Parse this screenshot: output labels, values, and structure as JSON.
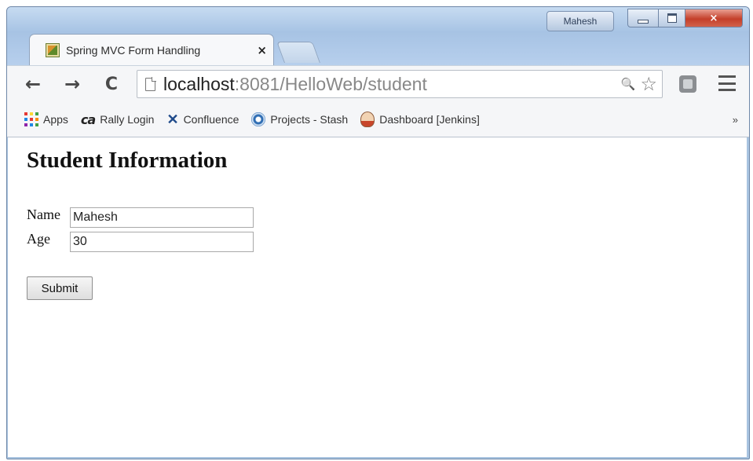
{
  "window": {
    "user_badge": "Mahesh",
    "controls": {
      "minimize": "minimize",
      "maximize": "maximize",
      "close": "×"
    }
  },
  "tab": {
    "title": "Spring MVC Form Handling",
    "close": "×",
    "favicon": "spring-leaf-icon"
  },
  "toolbar": {
    "back": "←",
    "forward": "→",
    "reload": "C",
    "url_host": "localhost",
    "url_rest": ":8081/HelloWeb/student",
    "zoom_icon": "🔍",
    "star_icon": "☆"
  },
  "bookmarks": {
    "items": [
      {
        "label": "Apps",
        "icon": "apps-grid-icon"
      },
      {
        "label": "Rally Login",
        "icon": "ca-logo-icon"
      },
      {
        "label": "Confluence",
        "icon": "confluence-icon"
      },
      {
        "label": "Projects - Stash",
        "icon": "stash-icon"
      },
      {
        "label": "Dashboard [Jenkins]",
        "icon": "jenkins-icon"
      }
    ],
    "overflow": "»",
    "ca_text": "ca",
    "confluence_glyph": "✕"
  },
  "page": {
    "heading": "Student Information",
    "name_label": "Name",
    "name_value": "Mahesh",
    "age_label": "Age",
    "age_value": "30",
    "submit_label": "Submit"
  },
  "colors": {
    "frame": "#a9c4e0",
    "close_button": "#c43f2a",
    "apps_grid": [
      "#e53935",
      "#fdd835",
      "#43a047",
      "#1e88e5",
      "#e53935",
      "#fb8c00",
      "#8e24aa",
      "#1e88e5",
      "#43a047"
    ]
  }
}
